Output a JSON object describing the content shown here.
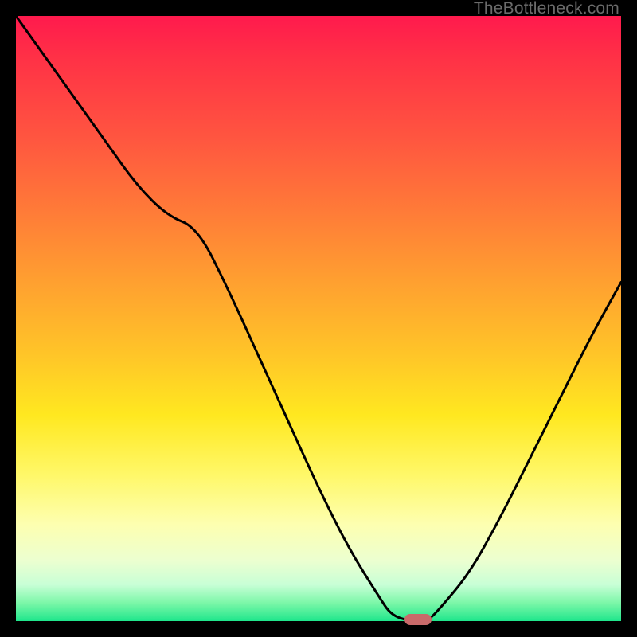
{
  "watermark": "TheBottleneck.com",
  "colors": {
    "frame": "#000000",
    "gradient_top": "#ff1a4d",
    "gradient_bottom": "#1fe68c",
    "curve": "#000000",
    "marker": "#c96a6a",
    "watermark_text": "#6b6b6b"
  },
  "chart_data": {
    "type": "line",
    "title": "",
    "xlabel": "",
    "ylabel": "",
    "xlim": [
      0,
      100
    ],
    "ylim": [
      0,
      100
    ],
    "grid": false,
    "legend": false,
    "series": [
      {
        "name": "bottleneck-curve",
        "x": [
          0,
          5,
          10,
          15,
          20,
          25,
          30,
          35,
          40,
          45,
          50,
          55,
          60,
          62,
          65,
          68,
          70,
          75,
          80,
          85,
          90,
          95,
          100
        ],
        "values": [
          100,
          93,
          86,
          79,
          72,
          67,
          65,
          55,
          44,
          33,
          22,
          12,
          4,
          1,
          0,
          0,
          2,
          8,
          17,
          27,
          37,
          47,
          56
        ]
      }
    ],
    "marker": {
      "x": 66.5,
      "y": 0
    }
  }
}
